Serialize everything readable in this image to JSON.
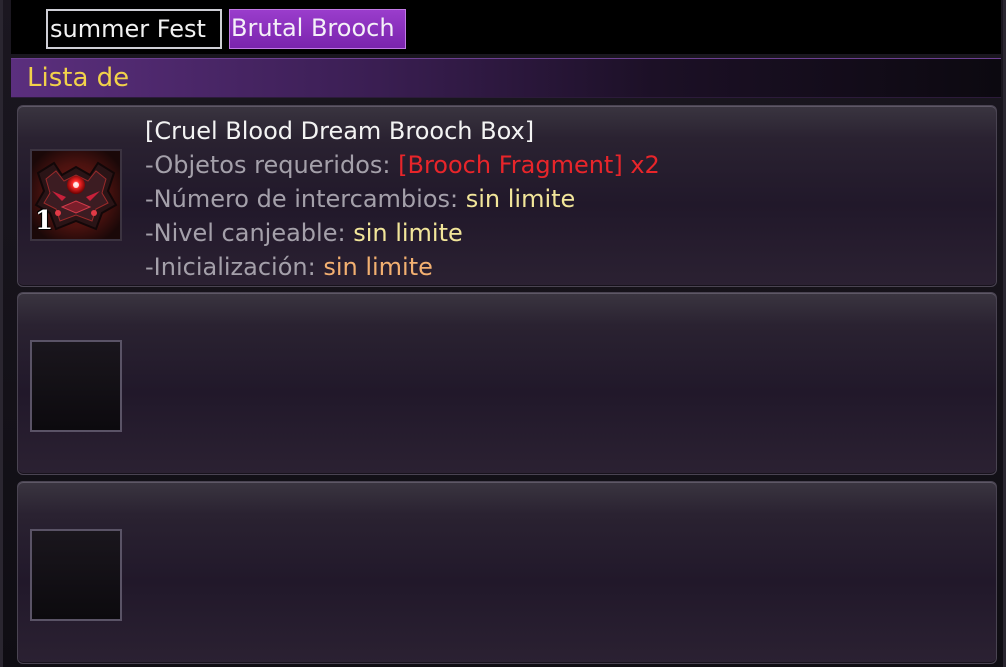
{
  "tabs": [
    {
      "label": "summer Fest",
      "active": false
    },
    {
      "label": "Brutal Brooch",
      "active": true
    }
  ],
  "list_header": "Lista de",
  "rows": [
    {
      "item_name": "[Cruel Blood Dream Brooch Box]",
      "quantity": "1",
      "icon": "demon-brooch-box-icon",
      "lines": [
        {
          "label": "-Objetos requeridos:",
          "value": "[Brooch Fragment] x2",
          "value_color": "#e8252a"
        },
        {
          "label": "-Número de intercambios:",
          "value": "sin limite",
          "value_color": "#f2e69a"
        },
        {
          "label": "-Nivel canjeable:",
          "value": "sin limite",
          "value_color": "#f2e69a"
        },
        {
          "label": "-Inicialización:",
          "value": "sin limite",
          "value_color": "#f3b071"
        }
      ]
    },
    {
      "empty": true
    },
    {
      "empty": true
    }
  ],
  "colors": {
    "active_tab": "#8a2fbf",
    "header_text": "#f2d24a",
    "label_text": "#a4a0aa"
  }
}
